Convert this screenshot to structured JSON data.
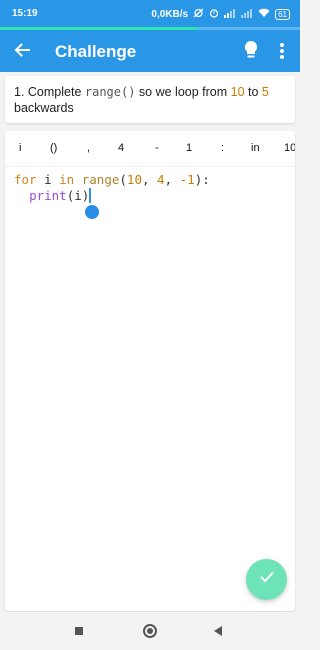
{
  "status_bar": {
    "time": "15:19",
    "network_speed": "0,0KB/s",
    "battery": "61",
    "icons": [
      "data-saver-icon",
      "alarm-icon",
      "signal-icon",
      "signal-icon",
      "wifi-icon",
      "battery-icon"
    ]
  },
  "progress": {
    "fraction": 0.66,
    "color": "#2ee3b0"
  },
  "app_bar": {
    "title": "Challenge",
    "color": "#2a97e6",
    "icons": [
      "back-arrow-icon",
      "lightbulb-icon",
      "more-vert-icon"
    ]
  },
  "question": {
    "prefix": "1. Complete ",
    "code": "range()",
    "middle": " so we loop from ",
    "from": "10",
    "to_word": " to ",
    "to": "5",
    "suffix": "backwards"
  },
  "tokens": [
    "i",
    "()",
    ",",
    "4",
    "-",
    "1",
    ":",
    "in",
    "10"
  ],
  "code": {
    "line1": {
      "for": "for",
      "var": " i ",
      "in": "in",
      "space": " ",
      "range": "range",
      "args_open": "(",
      "a1": "10",
      "sep1": ", ",
      "a2": "4",
      "sep2": ", ",
      "a3": "-1",
      "close": "):"
    },
    "line2": {
      "indent": "  ",
      "print": "print",
      "args": "(i)"
    }
  },
  "fab": {
    "icon": "checkmark-icon",
    "color": "#6ee3b8"
  },
  "nav_bar": {
    "icons": [
      "recents-square-icon",
      "home-circle-icon",
      "back-triangle-icon"
    ]
  }
}
